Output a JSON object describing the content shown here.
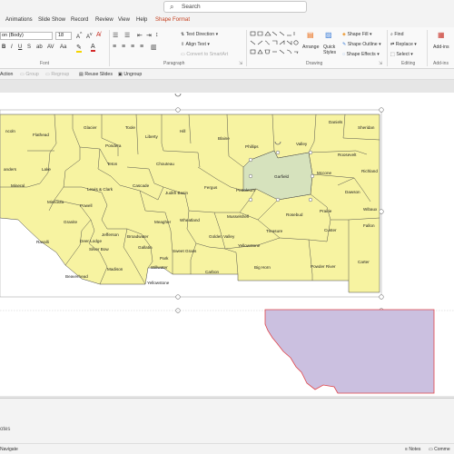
{
  "search": {
    "placeholder": "Search"
  },
  "tabs": [
    "Animations",
    "Slide Show",
    "Record",
    "Review",
    "View",
    "Help",
    "Shape Format"
  ],
  "font": {
    "name": "on (Body)",
    "size": "18"
  },
  "ribbon": {
    "text_direction": "Text Direction",
    "align_text": "Align Text",
    "convert_smartart": "Convert to SmartArt",
    "arrange": "Arrange",
    "quick_styles": "Quick Styles",
    "shape_fill": "Shape Fill",
    "shape_outline": "Shape Outline",
    "shape_effects": "Shape Effects",
    "find": "Find",
    "replace": "Replace",
    "select": "Select",
    "addins": "Add-ins",
    "groups": {
      "font": "Font",
      "paragraph": "Paragraph",
      "drawing": "Drawing",
      "editing": "Editing",
      "addins": "Add-ins"
    }
  },
  "toolbar2": {
    "action": "Action",
    "group": "Group",
    "regroup": "Regroup",
    "reuse_slides": "Reuse Slides",
    "ungroup": "Ungroup"
  },
  "counties": [
    {
      "name": "Lincoln",
      "label": "ncoln"
    },
    {
      "name": "Flathead",
      "label": "Flathead"
    },
    {
      "name": "Glacier",
      "label": "Glacier"
    },
    {
      "name": "Toole",
      "label": "Toole"
    },
    {
      "name": "Liberty",
      "label": "Liberty"
    },
    {
      "name": "Hill",
      "label": "Hill"
    },
    {
      "name": "Blaine",
      "label": "Blaine"
    },
    {
      "name": "Phillips",
      "label": "Phillips"
    },
    {
      "name": "Valley",
      "label": "Valley"
    },
    {
      "name": "Daniels",
      "label": "Daniels"
    },
    {
      "name": "Sheridan",
      "label": "Sheridan"
    },
    {
      "name": "Roosevelt",
      "label": "Roosevelt"
    },
    {
      "name": "Richland",
      "label": "Richland"
    },
    {
      "name": "Pondera",
      "label": "Pondera"
    },
    {
      "name": "Teton",
      "label": "Teton"
    },
    {
      "name": "Chouteau",
      "label": "Chouteau"
    },
    {
      "name": "Sanders",
      "label": "anders"
    },
    {
      "name": "Lake",
      "label": "Lake"
    },
    {
      "name": "Mineral",
      "label": "Mineral"
    },
    {
      "name": "Missoula",
      "label": "Missoula"
    },
    {
      "name": "Lewis & Clark",
      "label": "Lewis & Clark"
    },
    {
      "name": "Cascade",
      "label": "Cascade"
    },
    {
      "name": "Judith Basin",
      "label": "Judith Basin"
    },
    {
      "name": "Fergus",
      "label": "Fergus"
    },
    {
      "name": "Petroleum",
      "label": "Petroleum"
    },
    {
      "name": "Garfield",
      "label": "Garfield"
    },
    {
      "name": "McCone",
      "label": "Mccone"
    },
    {
      "name": "Dawson",
      "label": "Dawson"
    },
    {
      "name": "Prairie",
      "label": "Prairie"
    },
    {
      "name": "Wibaux",
      "label": "Wibaux"
    },
    {
      "name": "Powell",
      "label": "Powell"
    },
    {
      "name": "Granite",
      "label": "Granite"
    },
    {
      "name": "Meagher",
      "label": "Meagher"
    },
    {
      "name": "Wheatland",
      "label": "Wheatland"
    },
    {
      "name": "Musselshell",
      "label": "Musselshell"
    },
    {
      "name": "Rosebud",
      "label": "Rosebud"
    },
    {
      "name": "Broadwater",
      "label": "Broadwater"
    },
    {
      "name": "Golden Valley",
      "label": "Golden Valley"
    },
    {
      "name": "Treasure",
      "label": "Treasure"
    },
    {
      "name": "Custer",
      "label": "Custer"
    },
    {
      "name": "Fallon",
      "label": "Fallon"
    },
    {
      "name": "Ravalli",
      "label": "Ravalli"
    },
    {
      "name": "Jefferson",
      "label": "Jefferson"
    },
    {
      "name": "Deer Lodge",
      "label": "Deer Lodge"
    },
    {
      "name": "Silver Bow",
      "label": "Silver Bow"
    },
    {
      "name": "Gallatin",
      "label": "Gallatin"
    },
    {
      "name": "Sweet Grass",
      "label": "Sweet Grass"
    },
    {
      "name": "Stillwater",
      "label": "Stillwater"
    },
    {
      "name": "Yellowstone",
      "label": "Yellowstone"
    },
    {
      "name": "Big Horn",
      "label": "Big Horn"
    },
    {
      "name": "Powder River",
      "label": "Powder River"
    },
    {
      "name": "Carter",
      "label": "Carter"
    },
    {
      "name": "Beaverhead",
      "label": "Beaverhead"
    },
    {
      "name": "Madison",
      "label": "Madison"
    },
    {
      "name": "Park",
      "label": "Park"
    },
    {
      "name": "Carbon",
      "label": "Carbon"
    },
    {
      "name": "Yellowstone National Park",
      "label": "Yellowstone"
    }
  ],
  "colors": {
    "county_fill": "#f7f3a1",
    "highlight_fill": "#d6e2bd",
    "shape_fill": "#cbc0e0",
    "shape_outline": "#e0444a",
    "accent": "#c43e1c"
  },
  "status": {
    "slide_label": "Navigate",
    "notes": "Notes",
    "comments": "Comme"
  },
  "notes_label": "otes"
}
